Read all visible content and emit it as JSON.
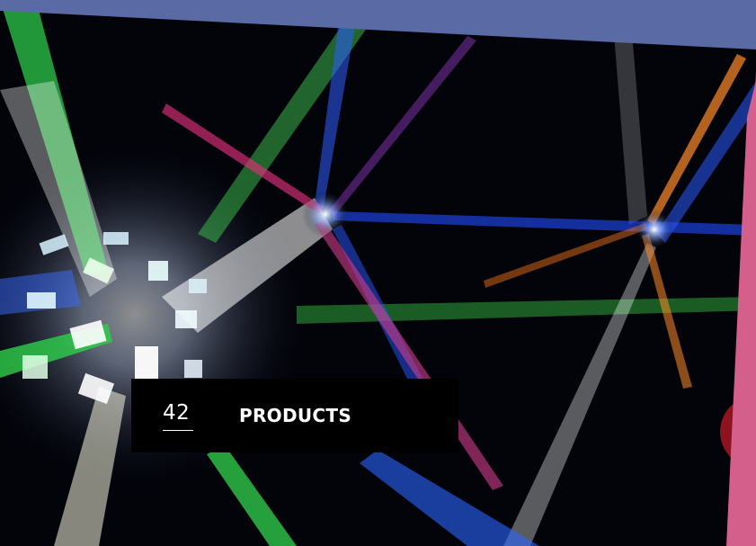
{
  "card": {
    "count": "42",
    "title": "PRODUCTS"
  },
  "colors": {
    "top_band": "#5a6aa5",
    "pink_strip": "#d45f8a",
    "card_bg": "#000000",
    "text": "#ffffff"
  },
  "image": {
    "subject": "disco-stage-lights-photo"
  }
}
